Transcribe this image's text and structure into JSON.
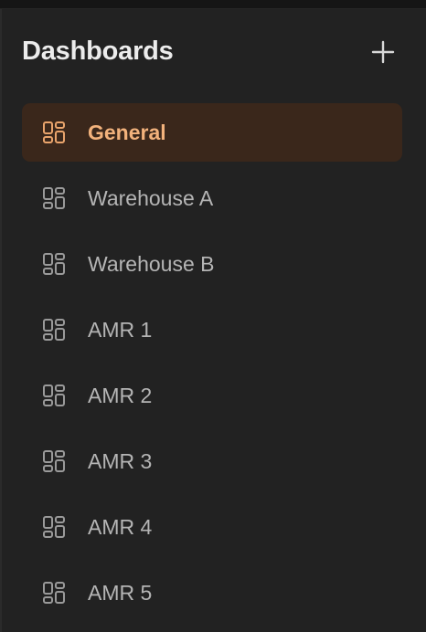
{
  "header": {
    "title": "Dashboards",
    "add_icon": "plus-icon"
  },
  "colors": {
    "active_bg": "#3a271b",
    "active_text": "#f2b27c",
    "item_text": "#b5b5b5",
    "icon_default": "#9a9a9a",
    "icon_active": "#e9a46c"
  },
  "dashboards": {
    "items": [
      {
        "label": "General",
        "icon": "dashboard-icon",
        "active": true
      },
      {
        "label": "Warehouse A",
        "icon": "dashboard-icon",
        "active": false
      },
      {
        "label": "Warehouse B",
        "icon": "dashboard-icon",
        "active": false
      },
      {
        "label": "AMR 1",
        "icon": "dashboard-icon",
        "active": false
      },
      {
        "label": "AMR 2",
        "icon": "dashboard-icon",
        "active": false
      },
      {
        "label": "AMR 3",
        "icon": "dashboard-icon",
        "active": false
      },
      {
        "label": "AMR 4",
        "icon": "dashboard-icon",
        "active": false
      },
      {
        "label": "AMR 5",
        "icon": "dashboard-icon",
        "active": false
      }
    ]
  }
}
